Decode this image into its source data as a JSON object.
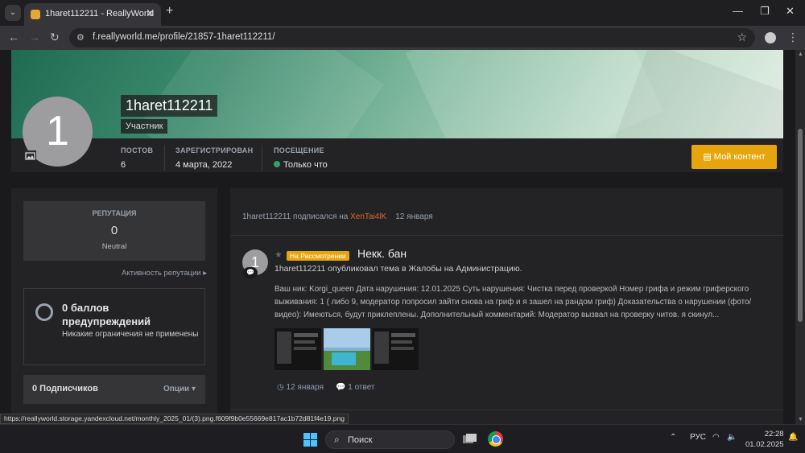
{
  "browser": {
    "tab_title": "1haret112211 - ReallyWorld",
    "tab_close": "✕",
    "new_tab": "+",
    "url": "f.reallyworld.me/profile/21857-1haret112211/",
    "status_url": "https://reallyworld.storage.yandexcloud.net/monthly_2025_01/(3).png.f609f9b0e55669e817ac1b72d81f4e19.png"
  },
  "profile": {
    "avatar_letter": "1",
    "username": "1haret112211",
    "group": "Участник",
    "stats": [
      {
        "label": "ПОСТОВ",
        "value": "6"
      },
      {
        "label": "ЗАРЕГИСТРИРОВАН",
        "value": "4 марта, 2022"
      },
      {
        "label": "ПОСЕЩЕНИЕ",
        "value": "Только что"
      }
    ],
    "my_content_button": "Мой контент"
  },
  "sidebar": {
    "reputation_label": "РЕПУТАЦИЯ",
    "reputation_value": "0",
    "reputation_text": "Neutral",
    "reputation_link": "Активность репутации ▸",
    "warnings_title": "0 баллов предупреждений",
    "warnings_sub": "Никакие ограничения не применены",
    "followers_title": "0 Подписчиков",
    "followers_options": "Опции ▾"
  },
  "feed": {
    "follow_row": {
      "user": "1haret112211",
      "action": "подписался на",
      "target": "XenTai4lK",
      "date": "12 января"
    },
    "post": {
      "avatar_letter": "1",
      "prefix": "На Рассмотрении",
      "title": "Некк. бан",
      "meta": "1haret112211 опубликовал тема в Жалобы на Администрацию.",
      "body": "Ваш ник: Korgi_queen Дата нарушения: 12.01.2025 Суть нарушения: Чистка перед проверкой Номер грифа и режим гриферского выживания: 1 ( либо 9, модератор попросил зайти снова на гриф и я зашел на рандом гриф) Доказательства о нарушении (фото/видео): Имеються, будут приклеплены. Дополнительный комментарий: Модератор вызвал на проверку читов. я скинул...",
      "date": "12 января",
      "replies": "1 ответ"
    }
  },
  "taskbar": {
    "search_placeholder": "Поиск",
    "lang": "РУС",
    "time": "22:28",
    "date": "01.02.2025"
  }
}
